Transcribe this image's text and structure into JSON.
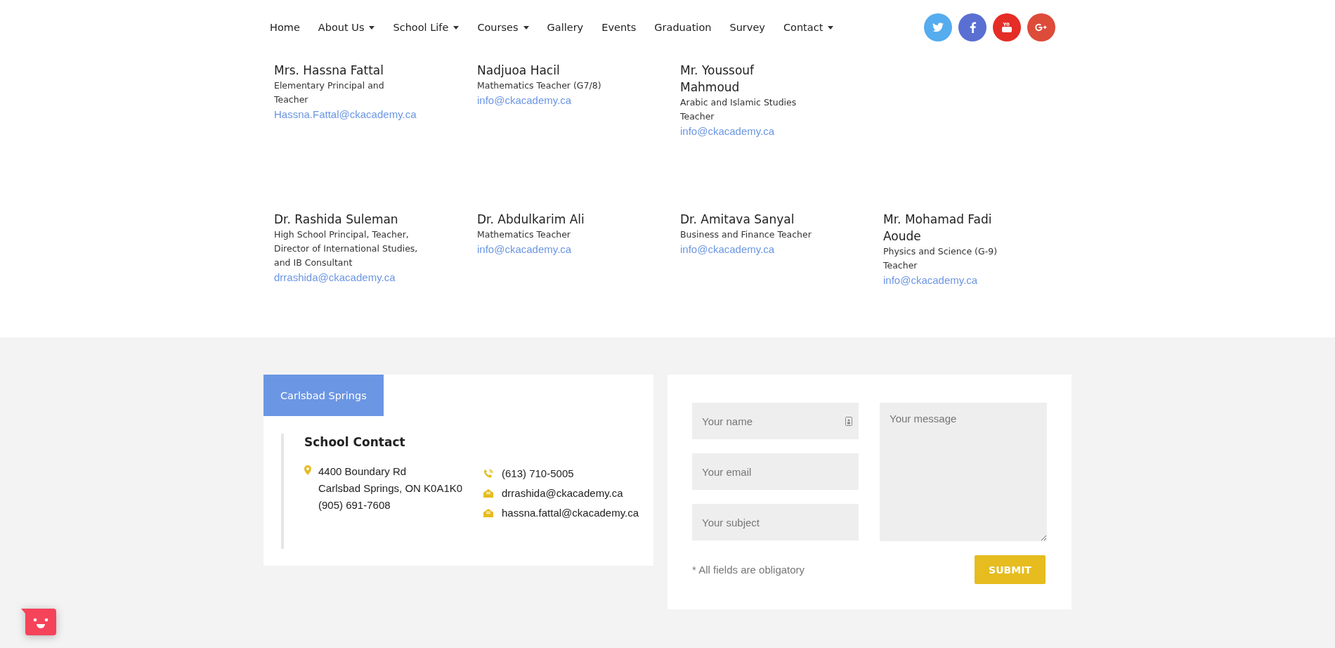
{
  "nav": {
    "items": [
      {
        "label": "Home",
        "dropdown": false
      },
      {
        "label": "About Us",
        "dropdown": true
      },
      {
        "label": "School Life",
        "dropdown": true
      },
      {
        "label": "Courses",
        "dropdown": true
      },
      {
        "label": "Gallery",
        "dropdown": false
      },
      {
        "label": "Events",
        "dropdown": false
      },
      {
        "label": "Graduation",
        "dropdown": false
      },
      {
        "label": "Survey",
        "dropdown": false
      },
      {
        "label": "Contact",
        "dropdown": true
      }
    ],
    "social": [
      {
        "kind": "twitter",
        "color": "#55acee"
      },
      {
        "kind": "facebook",
        "color": "#5a6fd2"
      },
      {
        "kind": "youtube",
        "color": "#e52d27"
      },
      {
        "kind": "googleplus",
        "color": "#dd4b39"
      }
    ]
  },
  "staff_rows": [
    [
      {
        "name": "Mrs. Hassna Fattal",
        "role": "Elementary Principal and Teacher",
        "email": "Hassna.Fattal@ckacademy.ca"
      },
      {
        "name": "Nadjuoa Hacil",
        "role": "Mathematics Teacher (G7/8)",
        "email": "info@ckacademy.ca"
      },
      {
        "name": "Mr. Youssouf Mahmoud",
        "role": "Arabic and Islamic Studies Teacher",
        "email": "info@ckacademy.ca"
      }
    ],
    [
      {
        "name": "Dr. Rashida Suleman",
        "role": "High School Principal, Teacher, Director of International Studies, and IB Consultant",
        "email": "drrashida@ckacademy.ca"
      },
      {
        "name": "Dr. Abdulkarim Ali",
        "role": "Mathematics Teacher",
        "email": "info@ckacademy.ca"
      },
      {
        "name": "Dr. Amitava Sanyal",
        "role": "Business and Finance Teacher",
        "email": "info@ckacademy.ca"
      },
      {
        "name": "Mr. Mohamad Fadi Aoude",
        "role": "Physics and Science (G-9) Teacher",
        "email": "info@ckacademy.ca"
      }
    ]
  ],
  "contact": {
    "tab": "Carlsbad Springs",
    "heading": "School Contact",
    "address": [
      "4400 Boundary Rd",
      "Carlsbad Springs, ON K0A1K0",
      "(905) 691-7608"
    ],
    "lines": [
      {
        "kind": "phone",
        "text": "(613) 710-5005"
      },
      {
        "kind": "email",
        "text": "drrashida@ckacademy.ca"
      },
      {
        "kind": "email",
        "text": "hassna.fattal@ckacademy.ca"
      }
    ]
  },
  "form": {
    "name": {
      "placeholder": "Your name"
    },
    "email": {
      "placeholder": "Your email"
    },
    "subject": {
      "placeholder": "Your subject"
    },
    "message": {
      "placeholder": "Your message"
    },
    "note": "* All fields are obligatory",
    "submit": "SUBMIT"
  }
}
